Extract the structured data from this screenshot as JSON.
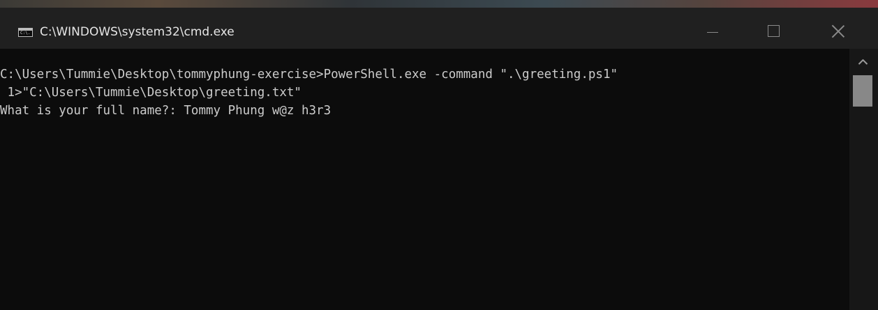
{
  "window": {
    "title": "C:\\WINDOWS\\system32\\cmd.exe",
    "icon_label": "C:\\.",
    "controls": {
      "minimize": "minimize-icon",
      "maximize": "maximize-icon",
      "close": "close-icon"
    }
  },
  "console": {
    "lines": [
      "C:\\Users\\Tummie\\Desktop\\tommyphung-exercise>PowerShell.exe -command \".\\greeting.ps1\"",
      " 1>\"C:\\Users\\Tummie\\Desktop\\greeting.txt\"",
      "What is your full name?: Tommy Phung w@z h3r3"
    ]
  },
  "colors": {
    "console_background": "#0c0c0c",
    "console_text": "#cccccc",
    "titlebar_background": "#202020",
    "scrollbar_track": "#171717",
    "scrollbar_thumb": "#888888"
  }
}
